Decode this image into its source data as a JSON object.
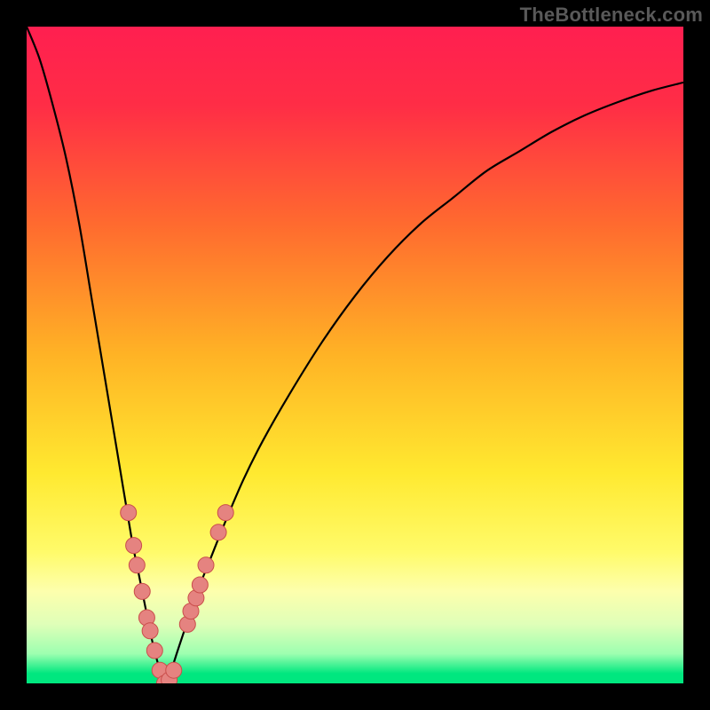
{
  "attribution": "TheBottleneck.com",
  "colors": {
    "frame": "#000000",
    "curve_stroke": "#000000",
    "dot_fill": "#e58380",
    "dot_stroke": "#ca4e4b",
    "gradient_stops": [
      {
        "offset": 0.0,
        "color": "#ff1f50"
      },
      {
        "offset": 0.12,
        "color": "#ff2d46"
      },
      {
        "offset": 0.3,
        "color": "#ff6a2f"
      },
      {
        "offset": 0.5,
        "color": "#ffb325"
      },
      {
        "offset": 0.68,
        "color": "#ffe930"
      },
      {
        "offset": 0.8,
        "color": "#fffb6a"
      },
      {
        "offset": 0.86,
        "color": "#fdffad"
      },
      {
        "offset": 0.91,
        "color": "#dfffb8"
      },
      {
        "offset": 0.955,
        "color": "#9dffb0"
      },
      {
        "offset": 0.985,
        "color": "#00e77f"
      },
      {
        "offset": 1.0,
        "color": "#00e77f"
      }
    ]
  },
  "chart_data": {
    "type": "line",
    "title": "",
    "xlabel": "",
    "ylabel": "",
    "xlim": [
      0,
      100
    ],
    "ylim": [
      0,
      100
    ],
    "grid": false,
    "legend": false,
    "notes": "V-shaped bottleneck curve. y≈0 at the optimum x≈21; y rises steeply toward 100 as x→0 and more gently toward ~100 as x→100. Dots cluster near the trough (~28% height and below).",
    "series": [
      {
        "name": "bottleneck-curve",
        "x": [
          0,
          2,
          4,
          6,
          8,
          10,
          12,
          14,
          16,
          17,
          18,
          19,
          20,
          21,
          22,
          23,
          24,
          25,
          26,
          28,
          30,
          33,
          36,
          40,
          45,
          50,
          55,
          60,
          65,
          70,
          75,
          80,
          85,
          90,
          95,
          100
        ],
        "y": [
          100,
          95,
          88,
          80,
          70,
          58,
          46,
          34,
          22,
          17,
          12,
          7,
          3,
          0,
          2,
          5,
          8,
          11,
          14,
          19,
          24,
          31,
          37,
          44,
          52,
          59,
          65,
          70,
          74,
          78,
          81,
          84,
          86.5,
          88.5,
          90.2,
          91.5
        ]
      }
    ],
    "points": [
      {
        "name": "p1",
        "x": 15.5,
        "y": 26
      },
      {
        "name": "p2",
        "x": 16.3,
        "y": 21
      },
      {
        "name": "p3",
        "x": 16.8,
        "y": 18
      },
      {
        "name": "p4",
        "x": 17.6,
        "y": 14
      },
      {
        "name": "p5",
        "x": 18.3,
        "y": 10
      },
      {
        "name": "p6",
        "x": 18.8,
        "y": 8
      },
      {
        "name": "p7",
        "x": 19.5,
        "y": 5
      },
      {
        "name": "p8",
        "x": 20.3,
        "y": 2
      },
      {
        "name": "p9",
        "x": 21.0,
        "y": 0
      },
      {
        "name": "p10",
        "x": 21.7,
        "y": 0.5
      },
      {
        "name": "p11",
        "x": 22.4,
        "y": 2
      },
      {
        "name": "p12",
        "x": 24.5,
        "y": 9
      },
      {
        "name": "p13",
        "x": 25.0,
        "y": 11
      },
      {
        "name": "p14",
        "x": 25.8,
        "y": 13
      },
      {
        "name": "p15",
        "x": 26.4,
        "y": 15
      },
      {
        "name": "p16",
        "x": 27.3,
        "y": 18
      },
      {
        "name": "p17",
        "x": 29.2,
        "y": 23
      },
      {
        "name": "p18",
        "x": 30.3,
        "y": 26
      }
    ]
  }
}
